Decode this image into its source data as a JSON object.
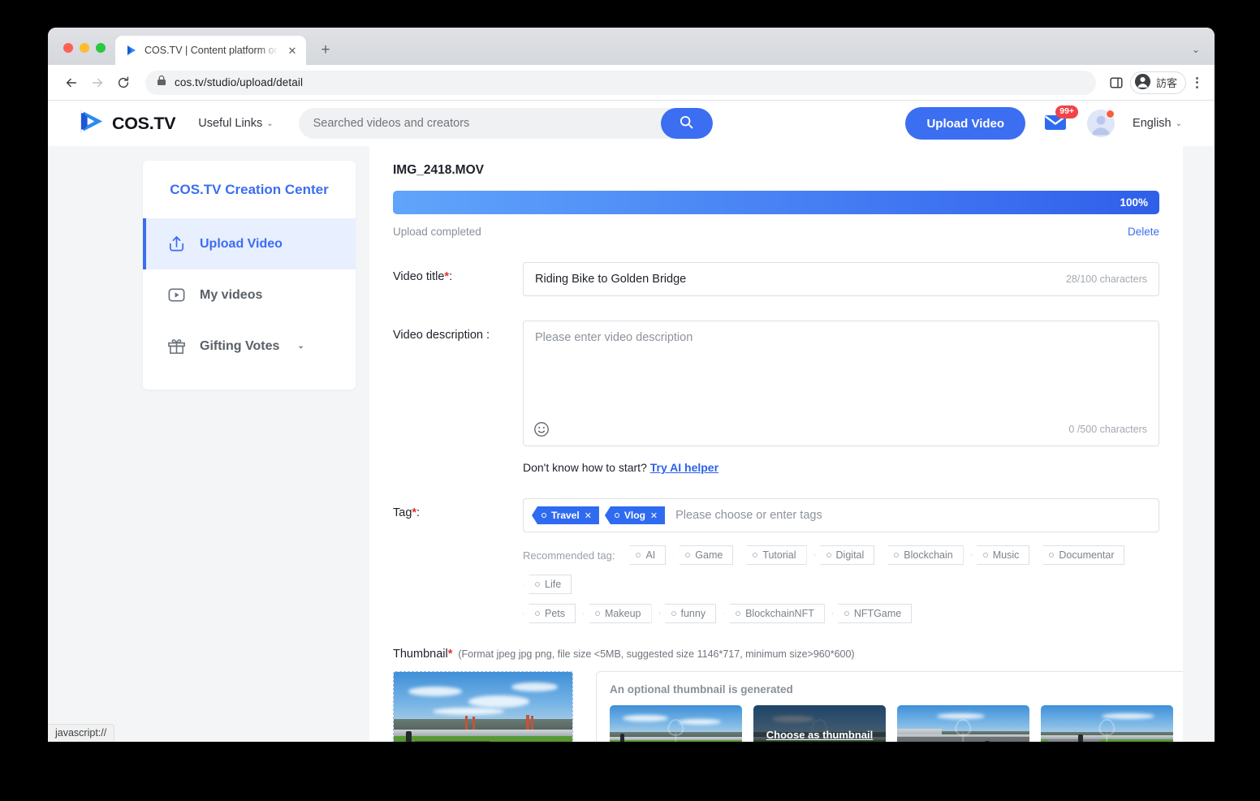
{
  "browser": {
    "tab_title": "COS.TV | Content platform on b",
    "tab_close_glyph": "✕",
    "new_tab_glyph": "+",
    "tabstrip_chevron": "⌄",
    "url": "cos.tv/studio/upload/detail",
    "profile_label": "訪客",
    "status_bubble": "javascript://"
  },
  "header": {
    "brand": "COS.TV",
    "useful_links": "Useful Links",
    "chevron": "⌄",
    "search_placeholder": "Searched videos and creators",
    "search_value": "",
    "upload_button": "Upload Video",
    "mail_badge": "99+",
    "language": "English"
  },
  "sidebar": {
    "title": "COS.TV Creation Center",
    "items": [
      {
        "label": "Upload Video",
        "icon": "upload-icon",
        "active": true
      },
      {
        "label": "My videos",
        "icon": "video-play-icon",
        "active": false
      },
      {
        "label": "Gifting Votes",
        "icon": "gift-icon",
        "active": false,
        "chevron": "⌄"
      }
    ]
  },
  "upload": {
    "file_name": "IMG_2418.MOV",
    "progress_percent": "100%",
    "progress_value": 100,
    "status_text": "Upload completed",
    "delete_label": "Delete"
  },
  "form": {
    "title_label": "Video title",
    "title_required": "*",
    "title_colon": ":",
    "title_value": "Riding Bike to Golden Bridge",
    "title_counter": "28/100 characters",
    "description_label": "Video description :",
    "description_placeholder": "Please enter video description",
    "description_counter": "0 /500 characters",
    "ai_hint_text": "Don't know how to start?",
    "ai_hint_link": "Try AI helper",
    "tag_label": "Tag",
    "tag_required": "*",
    "tag_colon": ":",
    "tag_placeholder": "Please choose or enter tags",
    "selected_tags": [
      "Travel",
      "Vlog"
    ],
    "tag_remove_glyph": "✕",
    "recommended_label": "Recommended tag:",
    "recommended_tags_row1": [
      "AI",
      "Game",
      "Tutorial",
      "Digital",
      "Blockchain",
      "Music",
      "Documentar",
      "Life"
    ],
    "recommended_tags_row2": [
      "Pets",
      "Makeup",
      "funny",
      "BlockchainNFT",
      "NFTGame"
    ]
  },
  "thumbnail": {
    "label": "Thumbnail",
    "required": "*",
    "note": "(Format jpeg jpg png, file size <5MB, suggested size 1146*717, minimum size>960*600)",
    "generated_title": "An optional thumbnail is generated",
    "choose_label": "Choose as thumbnail",
    "generated_count": 4,
    "hovered_index": 1
  },
  "colors": {
    "accent": "#3b6ef0",
    "accent_soft": "#e8efff",
    "danger": "#e03131",
    "badge_red": "#f0434a",
    "muted": "#8a9099",
    "page_bg": "#f4f5f6"
  }
}
